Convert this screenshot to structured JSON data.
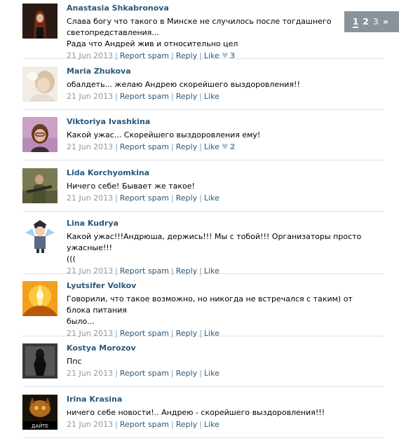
{
  "comments": [
    {
      "name": "Anastasia Shkabronova",
      "text": "Слава богу что такого в Минске не случилось после тогдашнего светопредставления...\nРада что Андрей жив и относительно цел",
      "date": "21 Jun 2013",
      "report": "Report spam",
      "reply": "Reply",
      "like": "Like",
      "like_count": "3"
    },
    {
      "name": "Maria Zhukova",
      "text": "обалдеть... желаю Андрею скорейшего выздоровления!!",
      "date": "21 Jun 2013",
      "report": "Report spam",
      "reply": "Reply",
      "like": "Like",
      "like_count": ""
    },
    {
      "name": "Viktoriya Ivashkina",
      "text": "Какой ужас... Скорейшего выздоровления ему!",
      "date": "21 Jun 2013",
      "report": "Report spam",
      "reply": "Reply",
      "like": "Like",
      "like_count": "2"
    },
    {
      "name": "Lida Korchyomkina",
      "text": "Ничего себе! Бывает же такое!",
      "date": "21 Jun 2013",
      "report": "Report spam",
      "reply": "Reply",
      "like": "Like",
      "like_count": ""
    },
    {
      "name": "Lina Kudrya",
      "text": "Какой ужас!!!Андрюша, держись!!! Мы с тобой!!! Организаторы просто ужасные!!!\n(((",
      "date": "21 Jun 2013",
      "report": "Report spam",
      "reply": "Reply",
      "like": "Like",
      "like_count": ""
    },
    {
      "name": "Lyutsifer Volkov",
      "text": "Говорили, что такое возможно, но никогда не встречался с таким) от блока питания\nбыло...",
      "date": "21 Jun 2013",
      "report": "Report spam",
      "reply": "Reply",
      "like": "Like",
      "like_count": ""
    },
    {
      "name": "Kostya Morozov",
      "text": "Ппс",
      "date": "21 Jun 2013",
      "report": "Report spam",
      "reply": "Reply",
      "like": "Like",
      "like_count": ""
    },
    {
      "name": "Irina Krasina",
      "text": "ничего себе новости!.. Андрею - скорейшего выздоровления!!!",
      "date": "21 Jun 2013",
      "report": "Report spam",
      "reply": "Reply",
      "like": "Like",
      "like_count": ""
    }
  ],
  "avatars": {
    "a4_caption": "ДАЙТЕ"
  },
  "pager": {
    "pages": [
      "1",
      "2",
      "3"
    ],
    "current": "1",
    "next": "»"
  },
  "colors": {
    "name_link": "#2b587a",
    "meta_gray": "#8c9aa6",
    "divider": "#dfe3ea"
  }
}
